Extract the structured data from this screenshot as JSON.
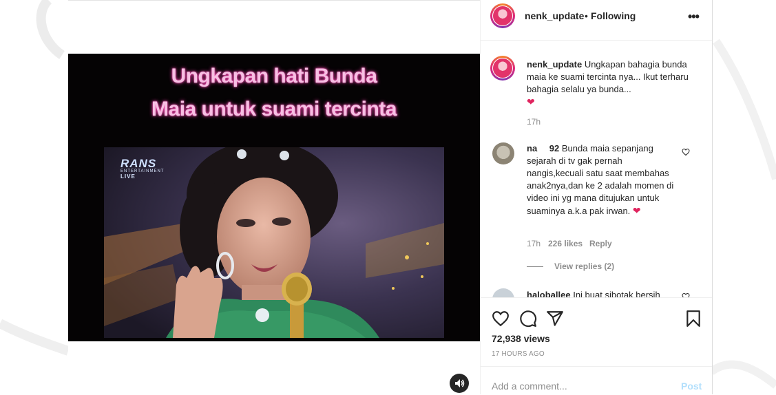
{
  "video": {
    "overlay_line1": "Ungkapan hati Bunda",
    "overlay_line2": "Maia untuk suami tercinta",
    "logo_main": "RANS",
    "logo_sub": "ENTERTAINMENT",
    "logo_live": "LIVE",
    "sound_icon": "speaker-icon"
  },
  "header": {
    "username": "nenk_update",
    "separator": "•",
    "follow_status": "Following",
    "more_icon": "more-options-icon"
  },
  "caption": {
    "username": "nenk_update",
    "text": "Ungkapan bahagia bunda maia ke suami tercinta nya... Ikut terharu bahagia selalu ya bunda...",
    "emoji": "❤",
    "time": "17h"
  },
  "comments": [
    {
      "username": "na",
      "username_suffix": "92",
      "text": "Bunda maia sepanjang sejarah di tv gak pernah nangis,kecuali satu saat membahas anak2nya,dan ke 2 adalah momen di video ini yg mana ditujukan untuk suaminya a.k.a pak irwan.",
      "emoji": "❤",
      "time": "17h",
      "likes": "226 likes",
      "reply": "Reply",
      "view_replies": "View replies (2)"
    },
    {
      "username": "haloballee",
      "text": "Ini buat sibotak bersih"
    }
  ],
  "actions": {
    "icons": [
      "heart-icon",
      "comment-icon",
      "share-icon",
      "bookmark-icon"
    ],
    "views": "72,938 views",
    "posted": "17 HOURS AGO"
  },
  "add_comment": {
    "placeholder": "Add a comment...",
    "post_label": "Post"
  },
  "colors": {
    "overlay_text": "#f7bfe3",
    "overlay_glow": "#ff3fb0",
    "post_disabled": "#b2dffc",
    "secondary_text": "#8e8e8e",
    "heart": "#e0245e"
  }
}
